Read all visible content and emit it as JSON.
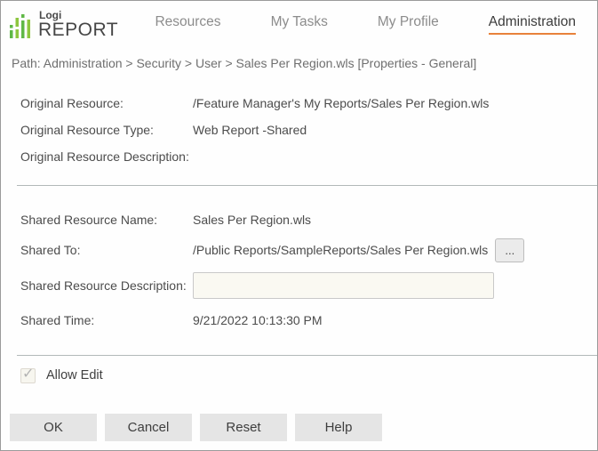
{
  "brand": {
    "logo_top": "Logi",
    "logo_main": "REPORT",
    "green_light": "#8dc63f",
    "green_dark": "#5fb846"
  },
  "nav": {
    "items": [
      {
        "label": "Resources",
        "active": false
      },
      {
        "label": "My Tasks",
        "active": false
      },
      {
        "label": "My Profile",
        "active": false
      },
      {
        "label": "Administration",
        "active": true
      }
    ],
    "active_underline_color": "#e8823b"
  },
  "breadcrumb": {
    "text": "Path: Administration > Security > User > Sales Per Region.wls [Properties - General]"
  },
  "form": {
    "original": {
      "resource_label": "Original Resource:",
      "resource_value": "/Feature Manager's My Reports/Sales Per Region.wls",
      "type_label": "Original Resource Type:",
      "type_value": "Web Report -Shared",
      "description_label": "Original Resource Description:",
      "description_value": ""
    },
    "shared": {
      "name_label": "Shared Resource Name:",
      "name_value": "Sales Per Region.wls",
      "shared_to_label": "Shared To:",
      "shared_to_value": "/Public Reports/SampleReports/Sales Per Region.wls",
      "browse_button_label": "...",
      "description_label": "Shared Resource Description:",
      "description_value": "",
      "description_placeholder": "",
      "time_label": "Shared Time:",
      "time_value": "9/21/2022 10:13:30 PM"
    },
    "allow_edit": {
      "label": "Allow Edit",
      "checked": true
    }
  },
  "icons": {
    "checkmark": "✓"
  },
  "buttons": {
    "ok": "OK",
    "cancel": "Cancel",
    "reset": "Reset",
    "help": "Help"
  }
}
